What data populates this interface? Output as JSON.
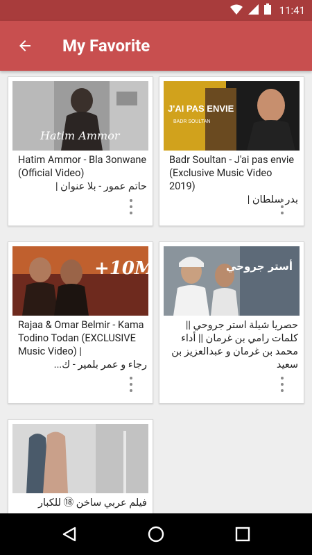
{
  "status_bar": {
    "time": "11:41"
  },
  "app_bar": {
    "title": "My Favorite"
  },
  "videos": [
    {
      "title": "Hatim Ammor - Bla 3onwane (Official Video)",
      "subtitle": "حاتم عمور - بلا عنوان |",
      "thumb_caption": "Hatim Ammor"
    },
    {
      "title": "Badr Soultan - J'ai pas envie (Exclusive Music Video 2019)",
      "subtitle": "بدر سلطان |",
      "thumb_caption": "J'AI PAS ENVIE",
      "thumb_subcaption": "BADR SOULTAN"
    },
    {
      "title": "Rajaa & Omar Belmir - Kama Todino Todan (EXCLUSIVE Music Video) |",
      "subtitle": "رجاء و عمر بلمير - ك...",
      "thumb_caption": "+10M"
    },
    {
      "title": "حصريا شيلة استر جروحي || كلمات رامي بن غرمان || أداء محمد بن غرمان و عبدالعزيز بن سعيد",
      "thumb_caption": "أستر جروحي"
    },
    {
      "title": "فيلم عربي ساخن ⑱ للكبار"
    }
  ],
  "colors": {
    "status_bar": "#a83c3c",
    "app_bar": "#c84f4f",
    "background": "#eeeeee",
    "card": "#ffffff",
    "nav_bar": "#000000"
  },
  "icons": {
    "back": "arrow-left-icon",
    "more": "more-vert-icon",
    "nav_back": "triangle-back-icon",
    "nav_home": "circle-home-icon",
    "nav_recents": "square-recents-icon"
  }
}
